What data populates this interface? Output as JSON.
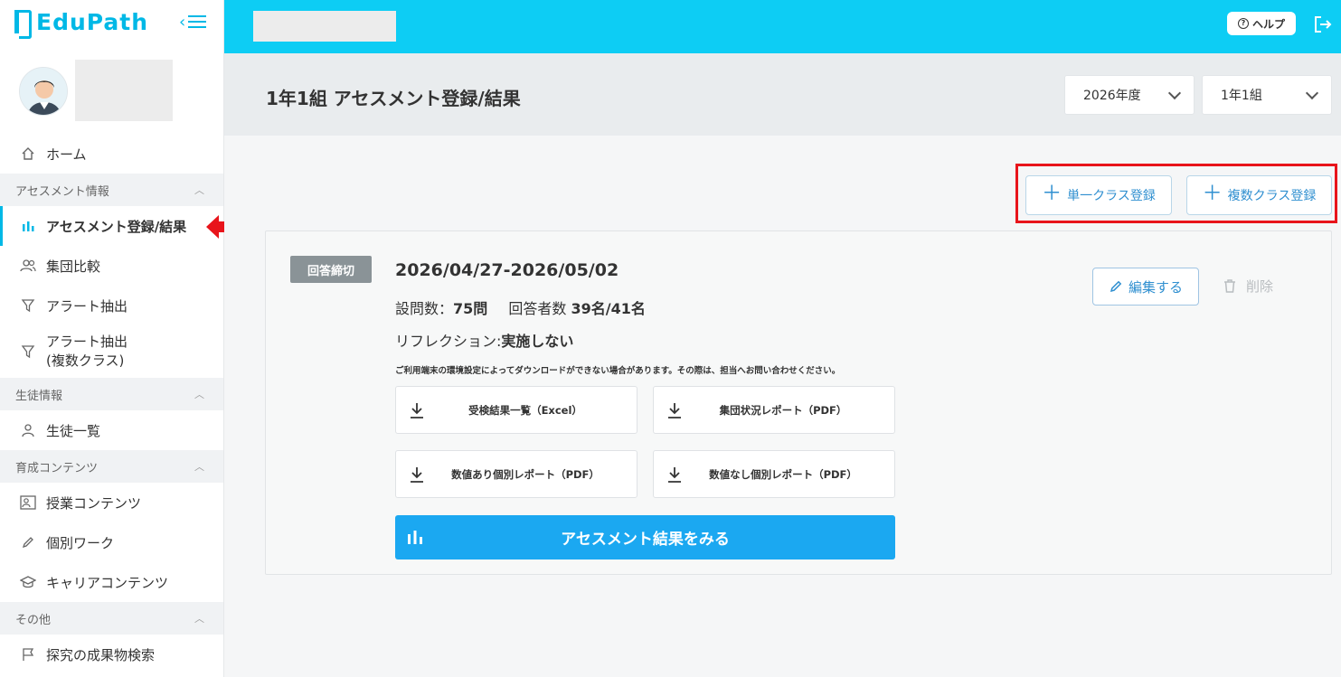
{
  "app": {
    "logo_text": "EduPath"
  },
  "header": {
    "help_label": "ヘルプ"
  },
  "page": {
    "title": "1年1組 アセスメント登録/結果",
    "year_select": "2026年度",
    "class_select": "1年1組"
  },
  "sidebar": {
    "home": "ホーム",
    "sections": {
      "assessment": "アセスメント情報",
      "students": "生徒情報",
      "content": "育成コンテンツ",
      "other": "その他"
    },
    "items": {
      "assessment_register": "アセスメント登録/結果",
      "group_compare": "集団比較",
      "alert_extract": "アラート抽出",
      "alert_extract_multi_1": "アラート抽出",
      "alert_extract_multi_2": "(複数クラス)",
      "student_list": "生徒一覧",
      "lesson_content": "授業コンテンツ",
      "individual_work": "個別ワーク",
      "career_content": "キャリアコンテンツ",
      "inquiry_search": "探究の成果物検索"
    }
  },
  "actions": {
    "single_register": "単一クラス登録",
    "multi_register": "複数クラス登録"
  },
  "card": {
    "status_badge": "回答締切",
    "period": "2026/04/27-2026/05/02",
    "questions_label": "設問数：",
    "questions_value": "75問",
    "respondents_label": "回答者数",
    "respondents_value": "39名/41名",
    "reflection_label": "リフレクション:",
    "reflection_value": "実施しない",
    "notice": "ご利用端末の環境設定によってダウンロードができない場合があります。その際は、担当へお問い合わせください。",
    "downloads": [
      "受検結果一覧（Excel）",
      "集団状況レポート（PDF）",
      "数値あり個別レポート（PDF）",
      "数値なし個別レポート（PDF）"
    ],
    "result_button": "アセスメント結果をみる",
    "edit_button": "編集する",
    "delete_button": "削除"
  },
  "colors": {
    "accent": "#0dcdf4",
    "primary_button": "#1ba8f1",
    "highlight": "#e8141b",
    "badge": "#8a9397"
  }
}
